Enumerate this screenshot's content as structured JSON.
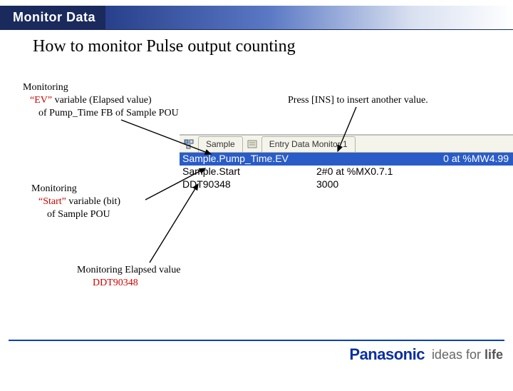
{
  "header": {
    "title": "Monitor Data"
  },
  "subtitle": "How to monitor Pulse output counting",
  "ann_ev": {
    "l1": "Monitoring",
    "l2_a": "“EV”",
    "l2_b": " variable (Elapsed value)",
    "l3": "of  Pump_Time FB of Sample POU"
  },
  "ann_ins": "Press [INS] to insert another value.",
  "ann_start": {
    "l1": "Monitoring",
    "l2_a": "“Start”",
    "l2_b": " variable (bit)",
    "l3": "of  Sample POU"
  },
  "ann_ddt": {
    "l1": "Monitoring Elapsed value",
    "l2": "DDT90348"
  },
  "monitor": {
    "tab1": "Sample",
    "tab2": "Entry Data Monitor 1",
    "rows": [
      {
        "name": "Sample.Pump_Time.EV",
        "val": "0 at %MW4.99"
      },
      {
        "name": "Sample.Start",
        "val": "2#0 at %MX0.7.1"
      },
      {
        "name": "DDT90348",
        "val": "3000"
      }
    ]
  },
  "footer": {
    "brand": "Panasonic",
    "tagline_a": "ideas for ",
    "tagline_b": "life"
  }
}
